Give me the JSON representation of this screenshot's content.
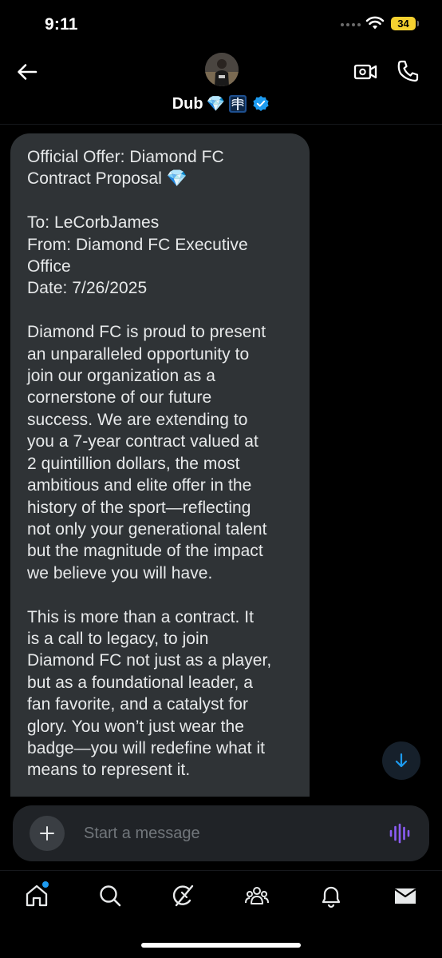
{
  "status_bar": {
    "time": "9:11",
    "battery": "34"
  },
  "header": {
    "contact_name": "Dub",
    "name_emoji_1": "💎",
    "name_emoji_2_icon": "xray-icon",
    "verified_icon": "verified-badge-icon",
    "back_icon": "back-arrow-icon",
    "video_icon": "video-call-icon",
    "call_icon": "phone-icon"
  },
  "message": {
    "text": "Official Offer: Diamond FC\nContract Proposal 💎\n\nTo: LeCorbJames\nFrom: Diamond FC Executive\nOffice\nDate: 7/26/2025\n\nDiamond FC is proud to present\nan unparalleled opportunity to\njoin our organization as a\ncornerstone of our future\nsuccess. We are extending to\nyou a 7-year contract valued at\n2 quintillion dollars, the most\nambitious and elite offer in the\nhistory of the sport—reflecting\nnot only your generational talent\nbut the magnitude of the impact\nwe believe you will have.\n\nThis is more than a contract. It\nis a call to legacy, to join\nDiamond FC not just as a player,\nbut as a foundational leader, a\nfan favorite, and a catalyst for\nglory. You won’t just wear the\nbadge—you will redefine what it\nmeans to represent it."
  },
  "composer": {
    "placeholder": "Start a message",
    "value": ""
  },
  "tabs": [
    {
      "name": "home",
      "icon": "home-icon",
      "has_notification_dot": true
    },
    {
      "name": "search",
      "icon": "search-icon"
    },
    {
      "name": "grok",
      "icon": "grok-icon"
    },
    {
      "name": "communities",
      "icon": "communities-icon"
    },
    {
      "name": "notifications",
      "icon": "bell-icon"
    },
    {
      "name": "messages",
      "icon": "mail-icon",
      "active": true
    }
  ],
  "colors": {
    "background": "#000000",
    "bubble": "#2f3336",
    "accent": "#1d9bf0",
    "battery": "#f5d130",
    "voice": "#8b5cf6"
  }
}
